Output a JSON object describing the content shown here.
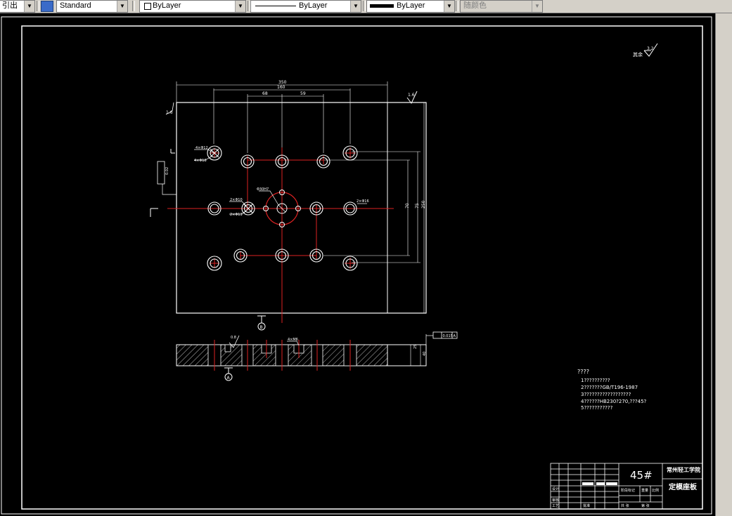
{
  "toolbar": {
    "dimstyle_partial": "引出",
    "textstyle": "Standard",
    "layer": "ByLayer",
    "linetype": "ByLayer",
    "lineweight": "ByLayer",
    "plotstyle": "随颜色"
  },
  "drawing": {
    "roughness_note": "其余",
    "roughness_value": "3.2",
    "roughness_top": "1.6",
    "dim_overall_width": "350",
    "dim_width_2": "160",
    "dim_half_left": "68",
    "dim_half_right": "59",
    "dim_side_heights": [
      "70",
      "75",
      "250"
    ],
    "left_mark": "1.6",
    "flatness_box": "0.02",
    "hole_label_1": "4×Φ12",
    "hole_label_2": "4×Φ18",
    "hole_label_3": "2×Φ10",
    "hole_label_4": "2×Φ13",
    "hole_label_5": "2×Φ16",
    "hole_label_6": "Φ30H7",
    "section_rough": "0.8",
    "section_callout": "4×M6",
    "section_thick_1": "25",
    "section_thick_2": "40",
    "view_marker_a": "A",
    "view_marker_b": "B",
    "tol_box": "0.015",
    "tol_ref": "A"
  },
  "notes": {
    "title": "????",
    "lines": [
      "1??????????",
      "2???????GB/T196-1987",
      "3??????????????????",
      "4??????HB230?270,???45?",
      "5???????????"
    ]
  },
  "title_block": {
    "material": "45#",
    "school": "常州轻工学院",
    "part_name": "定模座板",
    "row_labels": [
      "标记",
      "处数",
      "分区",
      "更改文件号",
      "签名",
      "年月日"
    ],
    "design": "设计",
    "check": "审核",
    "process": "工艺",
    "approve": "批准",
    "stage": "阶段标记",
    "weight": "重量",
    "scale": "比例",
    "sheets": "共 张",
    "sheet_no": "第 张"
  }
}
